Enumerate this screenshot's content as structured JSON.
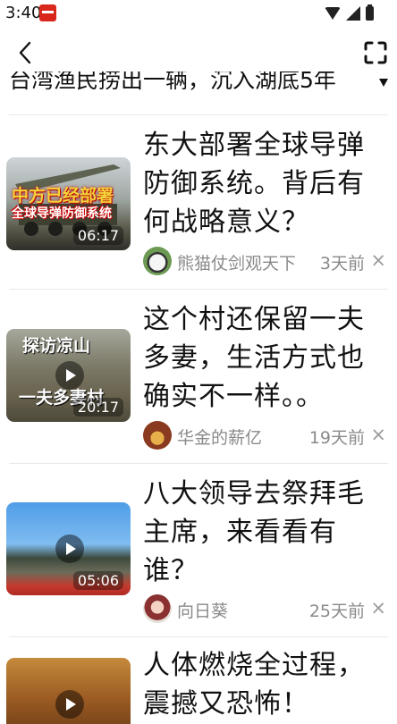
{
  "status_bar": {
    "time": "3:40"
  },
  "top_bar": {
    "back_icon": "chevron-left-icon",
    "expand_icon": "expand-icon"
  },
  "clipped_title": "台湾渔民捞出一辆，沉入湖底5年",
  "videos": [
    {
      "title": "东大部署全球导弹防御系统。背后有何战略意义？",
      "duration": "06:17",
      "thumb_caption_1": "中方已经部署",
      "thumb_caption_2": "全球导弹防御系统",
      "author": "熊猫仗剑观天下",
      "time": "3天前"
    },
    {
      "title": "这个村还保留一夫多妻，生活方式也确实不一样。。",
      "duration": "20:17",
      "thumb_caption_1": "探访凉山",
      "thumb_caption_2": "一夫多妻村",
      "author": "华金的薪亿",
      "time": "19天前"
    },
    {
      "title": "八大领导去祭拜毛主席，来看看有谁？",
      "duration": "05:06",
      "author": "向日葵",
      "time": "25天前"
    },
    {
      "title": "人体燃烧全过程，震撼又恐怖！"
    }
  ],
  "close_glyph": "×"
}
